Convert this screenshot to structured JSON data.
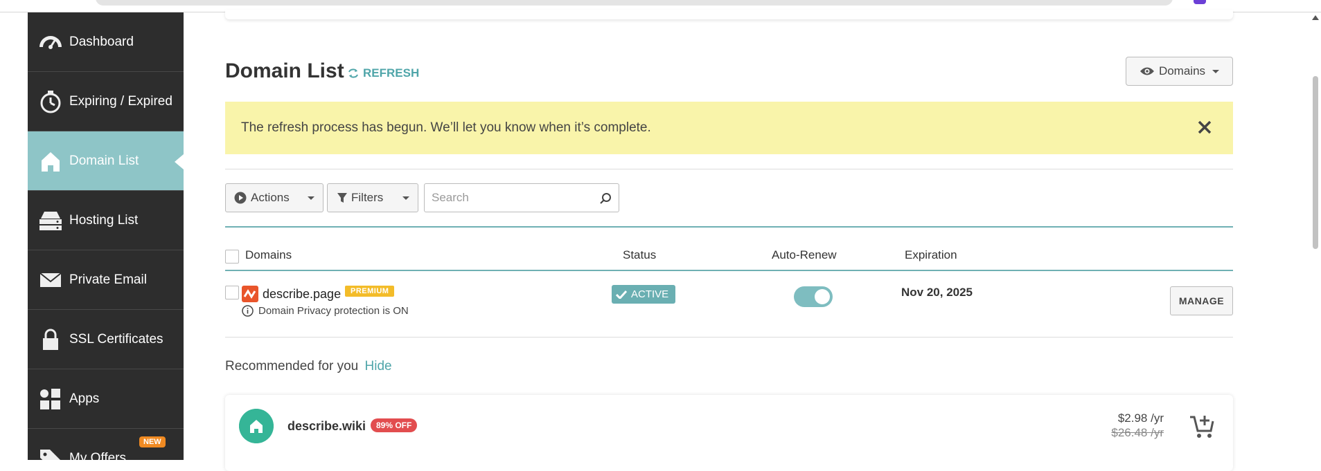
{
  "sidebar": {
    "items": [
      {
        "label": "Dashboard",
        "icon": "dashboard-gauge-icon"
      },
      {
        "label": "Expiring / Expired",
        "icon": "stopwatch-icon"
      },
      {
        "label": "Domain List",
        "icon": "home-icon",
        "active": true
      },
      {
        "label": "Hosting List",
        "icon": "server-icon"
      },
      {
        "label": "Private Email",
        "icon": "envelope-icon"
      },
      {
        "label": "SSL Certificates",
        "icon": "lock-icon"
      },
      {
        "label": "Apps",
        "icon": "apps-grid-icon"
      },
      {
        "label": "My Offers",
        "icon": "tag-icon",
        "badge": "NEW"
      }
    ]
  },
  "header": {
    "title": "Domain List",
    "refresh_label": "REFRESH",
    "view_button_label": "Domains"
  },
  "notice": {
    "message": "The refresh process has begun. We’ll let you know when it’s complete."
  },
  "toolbar": {
    "actions_label": "Actions",
    "filters_label": "Filters",
    "search_placeholder": "Search"
  },
  "table": {
    "columns": [
      "Domains",
      "Status",
      "Auto-Renew",
      "Expiration"
    ],
    "rows": [
      {
        "domain": "describe.page",
        "tag": "PREMIUM",
        "privacy": "Domain Privacy protection is ON",
        "status": "ACTIVE",
        "auto_renew": true,
        "expiration": "Nov 20, 2025",
        "action": "MANAGE"
      }
    ]
  },
  "recommended": {
    "title": "Recommended for you",
    "hide_label": "Hide",
    "items": [
      {
        "domain": "describe.wiki",
        "discount": "89% OFF",
        "price": "$2.98 /yr",
        "old_price": "$26.48 /yr"
      }
    ]
  },
  "colors": {
    "sidebar_bg": "#2d2d2d",
    "accent_teal": "#8ec5c7",
    "notice_bg": "#f9f4aa",
    "premium": "#f3bc29",
    "discount": "#e24d4f"
  }
}
